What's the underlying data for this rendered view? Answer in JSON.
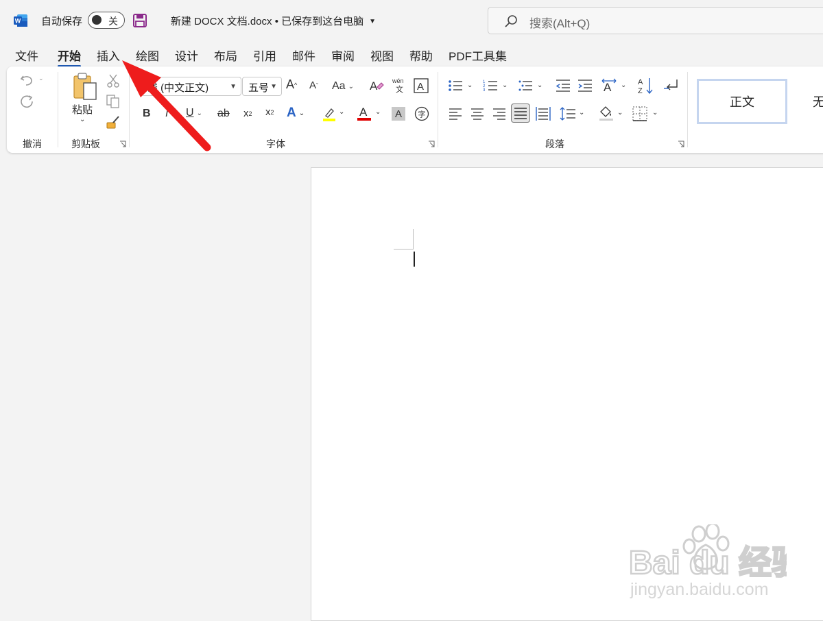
{
  "titlebar": {
    "autosave_label": "自动保存",
    "autosave_toggle": "关",
    "doc_title": "新建 DOCX 文档.docx • 已保存到这台电脑",
    "search_placeholder": "搜索(Alt+Q)"
  },
  "tabs": [
    {
      "label": "文件"
    },
    {
      "label": "开始",
      "active": true
    },
    {
      "label": "插入"
    },
    {
      "label": "绘图"
    },
    {
      "label": "设计"
    },
    {
      "label": "布局"
    },
    {
      "label": "引用"
    },
    {
      "label": "邮件"
    },
    {
      "label": "审阅"
    },
    {
      "label": "视图"
    },
    {
      "label": "帮助"
    },
    {
      "label": "PDF工具集"
    }
  ],
  "ribbon": {
    "groups": {
      "undo": "撤消",
      "clipboard": "剪贴板",
      "font": "字体",
      "paragraph": "段落"
    },
    "paste_label": "粘贴",
    "font_name": "线 (中文正文)",
    "font_size": "五号",
    "change_case": "Aa",
    "styles": [
      "正文",
      "无"
    ]
  },
  "icons": {
    "app": "word-icon",
    "save": "save-icon",
    "search": "search-icon"
  },
  "colors": {
    "accent": "#1f5ab3",
    "highlight": "#ffff00",
    "font_color": "#e00000",
    "annotation_arrow": "#ee1c1c"
  },
  "watermark": {
    "brand": "Bai du 经验",
    "url": "jingyan.baidu.com"
  }
}
